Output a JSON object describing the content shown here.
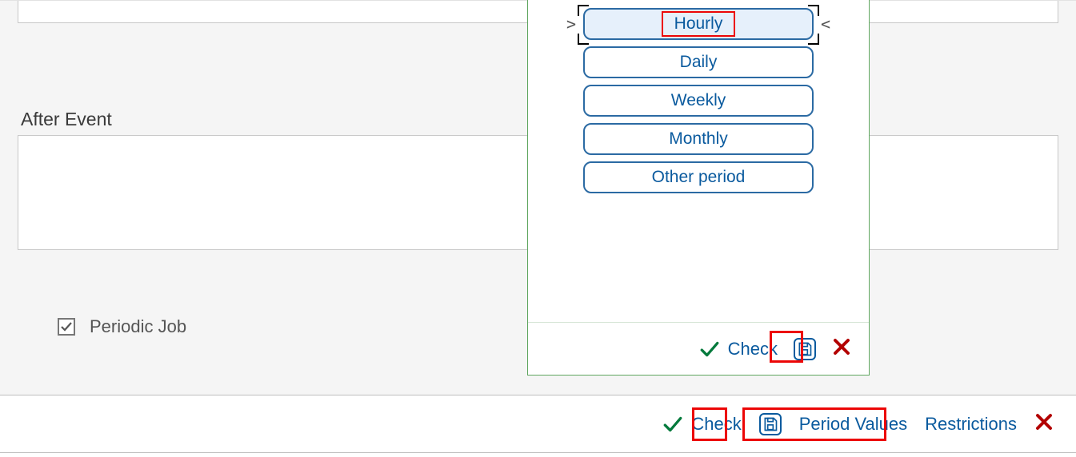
{
  "form": {
    "after_event_label": "After Event",
    "periodic_job_label": "Periodic Job",
    "periodic_job_checked": true
  },
  "popup": {
    "options": [
      "Hourly",
      "Daily",
      "Weekly",
      "Monthly",
      "Other period"
    ],
    "selected_index": 0,
    "footer": {
      "check_label": "Check"
    }
  },
  "footer": {
    "check_label": "Check",
    "period_values_label": "Period Values",
    "restrictions_label": "Restrictions"
  },
  "icons": {
    "save": "save-icon",
    "close": "close-icon",
    "check": "check-icon"
  },
  "colors": {
    "sap_blue": "#0a5a9e",
    "green": "#047a3c",
    "highlight": "#ec0606"
  }
}
